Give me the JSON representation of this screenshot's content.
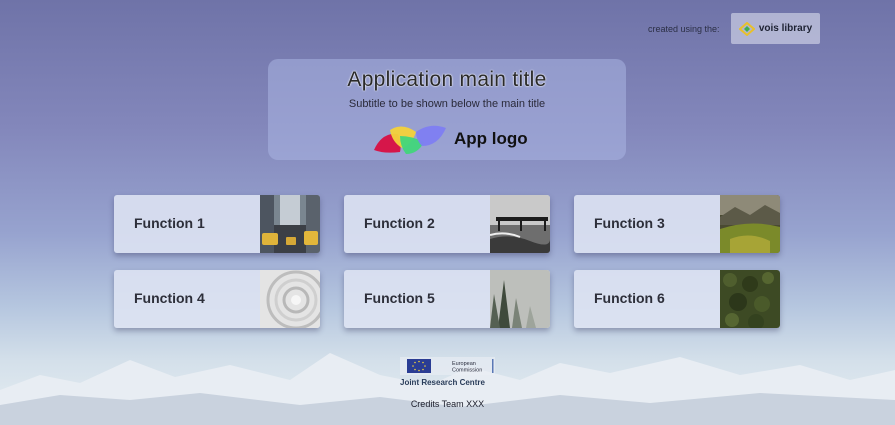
{
  "header": {
    "created_label": "created using the:",
    "vois_label": "vois library"
  },
  "title_panel": {
    "title": "Application main title",
    "subtitle": "Subtitle to be shown below the main title",
    "logo_label": "App logo"
  },
  "functions": [
    {
      "label": "Function 1",
      "image": "city-street-taxis"
    },
    {
      "label": "Function 2",
      "image": "pier-sea-bw"
    },
    {
      "label": "Function 3",
      "image": "valley-landscape"
    },
    {
      "label": "Function 4",
      "image": "spiral-architecture"
    },
    {
      "label": "Function 5",
      "image": "misty-forest"
    },
    {
      "label": "Function 6",
      "image": "aerial-forest"
    }
  ],
  "footer": {
    "ec_line1": "European",
    "ec_line2": "Commission",
    "jrc_label": "Joint Research Centre",
    "credits": "Credits Team XXX"
  },
  "colors": {
    "logo_red": "#d6164a",
    "logo_yellow": "#f3d23a",
    "logo_green": "#41d67b",
    "logo_blue": "#7e7ef2",
    "eu_blue": "#2a3d94"
  }
}
